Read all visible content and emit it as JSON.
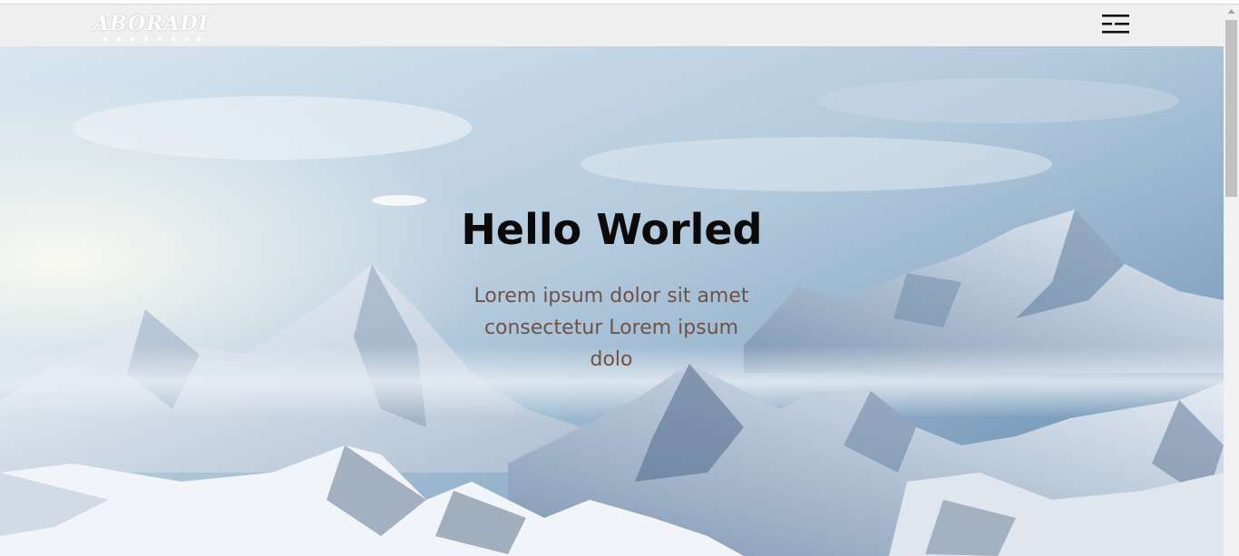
{
  "navbar": {
    "logo_text": "ABORADI",
    "menu_icon": "hamburger-menu-icon"
  },
  "hero": {
    "title": "Hello Worled",
    "subtitle": "Lorem ipsum dolor sit amet consectetur Lorem ipsum dolo",
    "background": "snowy-mountains-image"
  },
  "colors": {
    "navbar_bg": "#efefef",
    "title": "#0a0a0a",
    "subtitle": "#6e5246",
    "sky_top": "#a9c4db",
    "mountain_snow": "#eef2f7",
    "mountain_shadow": "#5b7696"
  }
}
